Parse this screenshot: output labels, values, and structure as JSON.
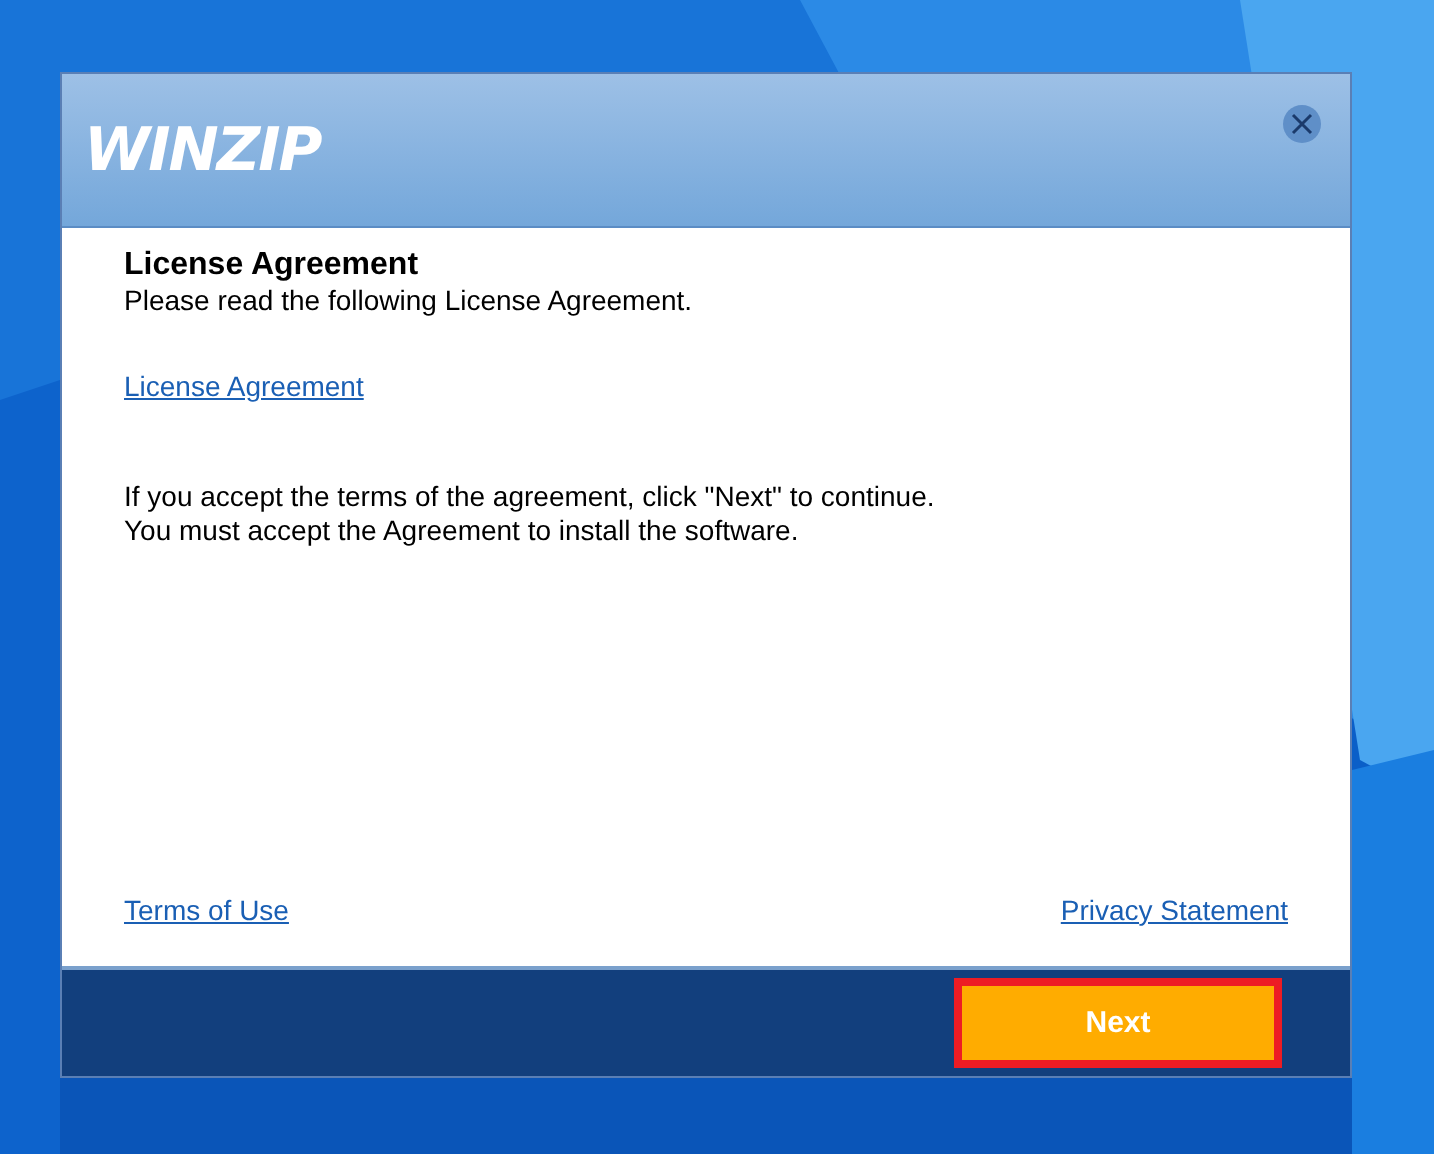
{
  "window": {
    "logo": "WINZIP"
  },
  "content": {
    "heading": "License Agreement",
    "subtitle": "Please read the following License Agreement.",
    "license_link": "License Agreement",
    "paragraphs": [
      "If you accept the terms of the agreement, click \"Next\" to continue.",
      "You must accept the Agreement to install the software."
    ],
    "footer_links": [
      "Terms of Use",
      "Privacy Statement"
    ]
  },
  "buttons": [
    {
      "label": "Next",
      "highlighted": true
    }
  ]
}
